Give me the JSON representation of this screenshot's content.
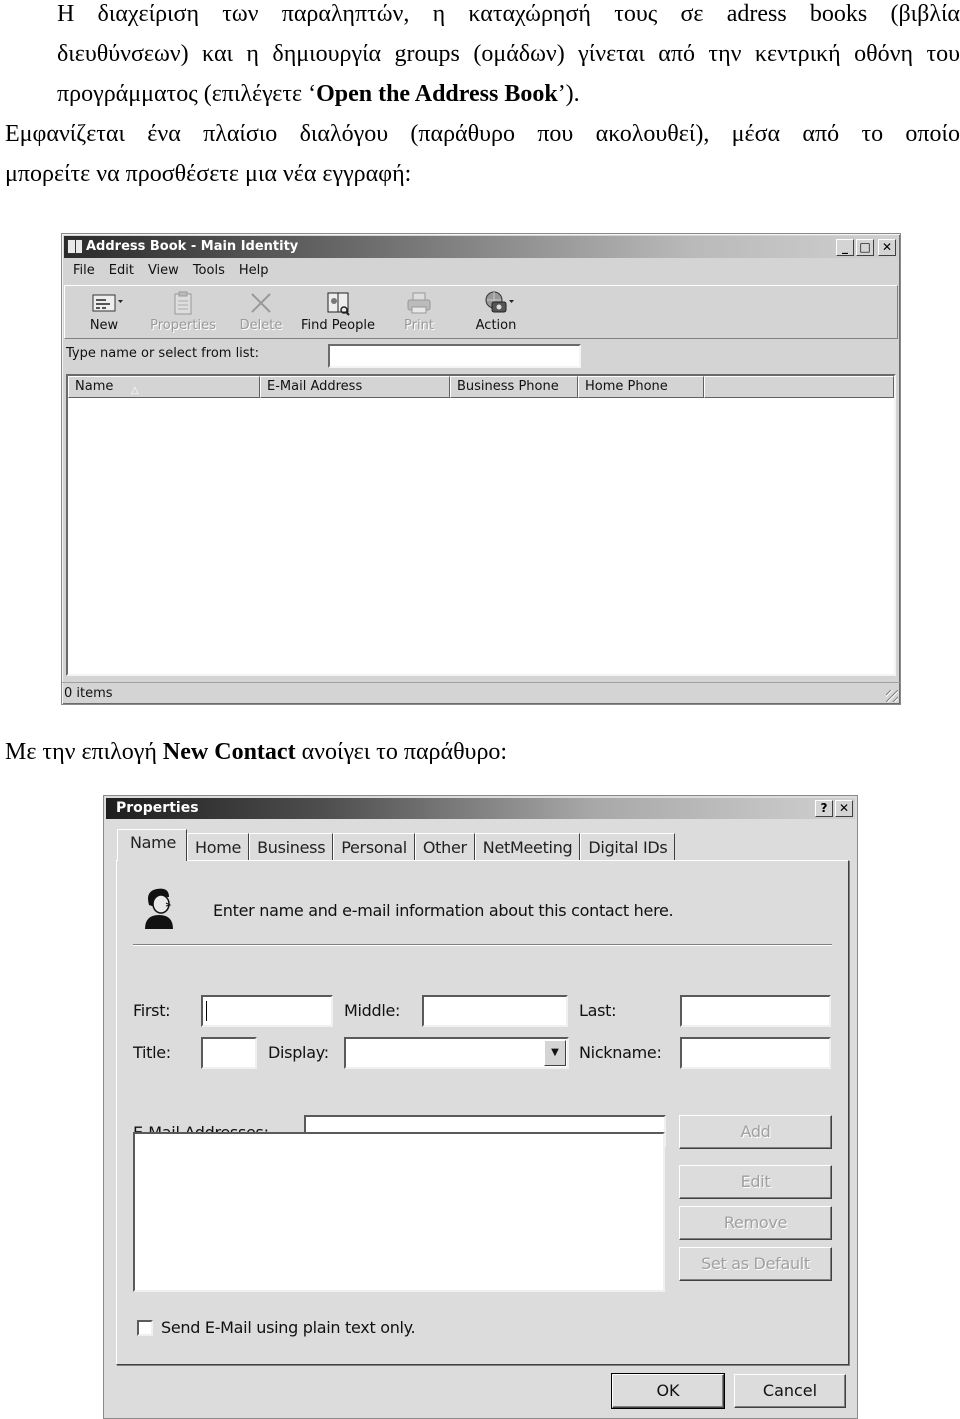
{
  "document": {
    "paragraph1": {
      "line1": "Η διαχείριση των παραληπτών, η καταχώρησή τους σε adress books (βιβλία",
      "line2": "διευθύνσεων) και η δημιουργία groups (ομάδων) γίνεται από την κεντρική οθόνη του",
      "line3_prefix": "προγράμματος (επιλέγετε ‘",
      "line3_bold": "Open the Address Book",
      "line3_suffix": "’)."
    },
    "paragraph2": {
      "line1": "Εμφανίζεται ένα πλαίσιο διαλόγου (παράθυρο που ακολουθεί), μέσα από το οποίο",
      "line2": "μπορείτε να προσθέσετε μια νέα εγγραφή:"
    },
    "paragraph3": {
      "prefix": "Με την επιλογή ",
      "bold": "New Contact",
      "suffix": " ανοίγει το παράθυρο:"
    }
  },
  "address_book": {
    "title": "Address Book - Main Identity",
    "window_buttons": {
      "minimize": "_",
      "maximize": "□",
      "close": "✕"
    },
    "menu": [
      "File",
      "Edit",
      "View",
      "Tools",
      "Help"
    ],
    "toolbar": [
      {
        "label": "New",
        "icon": "new-card-icon",
        "enabled": true,
        "dropdown": true
      },
      {
        "label": "Properties",
        "icon": "properties-icon",
        "enabled": false
      },
      {
        "label": "Delete",
        "icon": "delete-x-icon",
        "enabled": false
      },
      {
        "label": "Find People",
        "icon": "find-people-book-icon",
        "enabled": true
      },
      {
        "label": "Print",
        "icon": "printer-icon",
        "enabled": false
      },
      {
        "label": "Action",
        "icon": "globe-phone-icon",
        "enabled": true,
        "dropdown": true
      }
    ],
    "search": {
      "label": "Type name or select from list:",
      "value": ""
    },
    "columns": [
      "Name",
      "E-Mail Address",
      "Business Phone",
      "Home Phone",
      ""
    ],
    "sort_indicator": "△",
    "rows": [],
    "status": "0 items"
  },
  "properties_dialog": {
    "title": "Properties",
    "window_buttons": {
      "help": "?",
      "close": "✕"
    },
    "tabs": [
      "Name",
      "Home",
      "Business",
      "Personal",
      "Other",
      "NetMeeting",
      "Digital IDs"
    ],
    "active_tab": "Name",
    "intro": "Enter name and e-mail information about this contact here.",
    "fields": {
      "first": {
        "label": "First:",
        "value": ""
      },
      "middle": {
        "label": "Middle:",
        "value": ""
      },
      "last": {
        "label": "Last:",
        "value": ""
      },
      "title": {
        "label": "Title:",
        "value": ""
      },
      "display": {
        "label": "Display:",
        "value": ""
      },
      "nickname": {
        "label": "Nickname:",
        "value": ""
      },
      "email": {
        "label": "E-Mail Addresses:",
        "value": ""
      }
    },
    "email_buttons": [
      "Add",
      "Edit",
      "Remove",
      "Set as Default"
    ],
    "plain_text_checkbox": {
      "label": "Send E-Mail using plain text only.",
      "checked": false
    },
    "ok_label": "OK",
    "cancel_label": "Cancel"
  }
}
